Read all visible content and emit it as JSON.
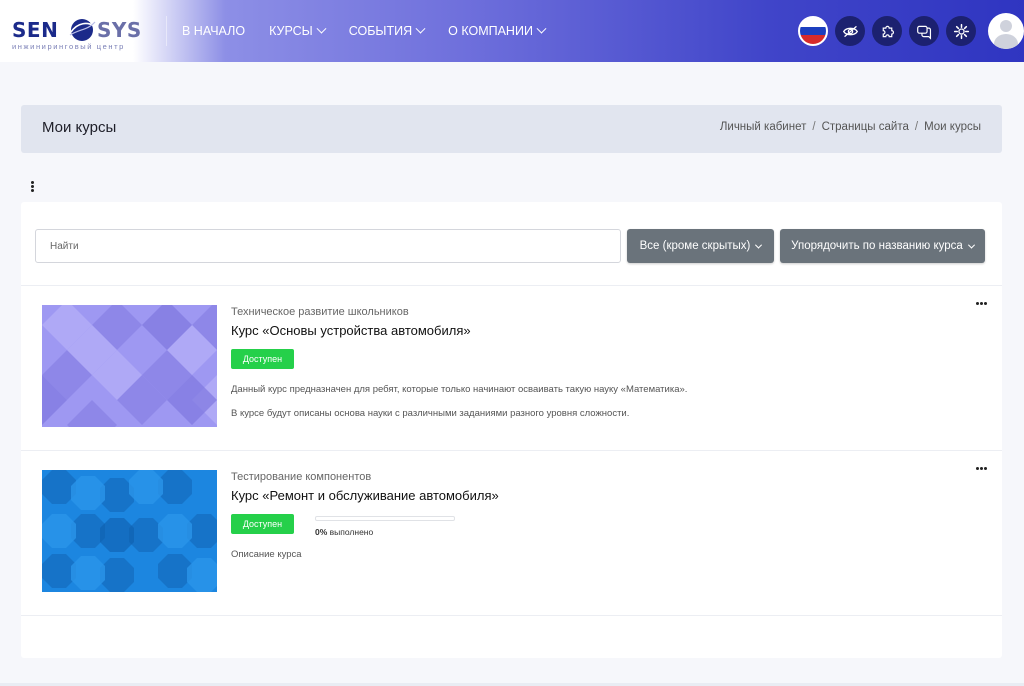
{
  "brand": {
    "word_left": "SEN",
    "word_right": "SYS",
    "subtitle": "инжиниринговый центр"
  },
  "nav": {
    "items": [
      {
        "label": "В НАЧАЛО",
        "has_dropdown": false
      },
      {
        "label": "КУРСЫ",
        "has_dropdown": true
      },
      {
        "label": "СОБЫТИЯ",
        "has_dropdown": true
      },
      {
        "label": "О КОМПАНИИ",
        "has_dropdown": true
      }
    ],
    "icons": [
      "russia-flag-icon",
      "eye-slash-icon",
      "puzzle-icon",
      "chat-icon",
      "gear-icon",
      "user-avatar"
    ]
  },
  "header": {
    "title": "Мои курсы",
    "breadcrumb": [
      "Личный кабинет",
      "Страницы сайта",
      "Мои курсы"
    ]
  },
  "filters": {
    "search_placeholder": "Найти",
    "grouping": "Все (кроме скрытых)",
    "sort": "Упорядочить по названию курса"
  },
  "courses": [
    {
      "category": "Техническое развитие школьников",
      "name": "Курс «Основы устройства автомобиля»",
      "badge": "Доступен",
      "description": [
        "Данный курс предназначен для ребят, которые только начинают осваивать такую науку «Математика».",
        "В курсе будут описаны основа науки с различными заданиями разного уровня сложности."
      ],
      "thumb_color": "#9b94f0"
    },
    {
      "category": "Тестирование компонентов",
      "name": "Курс «Ремонт и обслуживание автомобиля»",
      "badge": "Доступен",
      "progress_percent": 0,
      "progress_value": "0%",
      "progress_label": " выполнено",
      "description": [
        "Описание курса"
      ],
      "thumb_color": "#1a7fd9"
    }
  ],
  "colors": {
    "accent": "#25d04a",
    "nav_dark": "#1c2170",
    "button_gray": "#6a737b"
  }
}
